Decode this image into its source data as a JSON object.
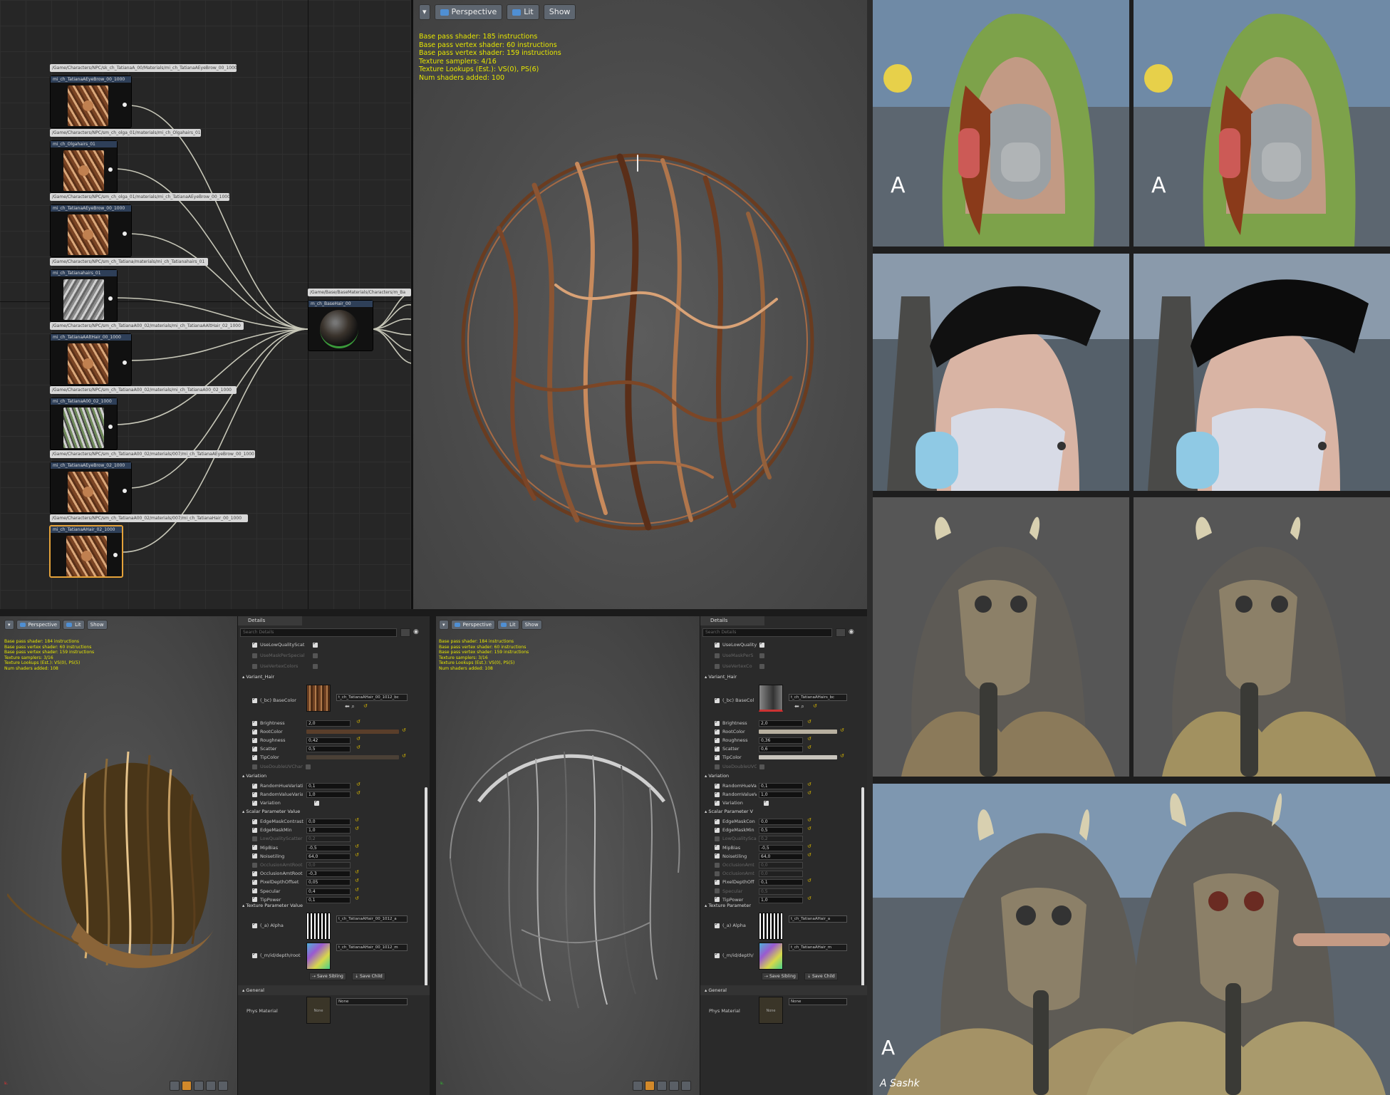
{
  "graph": {
    "nodes": [
      {
        "path": "/Game/Characters/NPC/sk_ch_TatianaA_00/Materials/mi_ch_TatianaAEyeBrow_00_1000",
        "title": "mi_ch_TatianaAEyeBrow_00_1000"
      },
      {
        "path": "/Game/Characters/NPC/sm_ch_olga_01/materials/mi_ch_Olgahairs_01",
        "title": "mi_ch_Olgahairs_01"
      },
      {
        "path": "/Game/Characters/NPC/sm_ch_olga_01/materials/mi_ch_TatianaAEyeBrow_00_1000",
        "title": "mi_ch_TatianaAEyeBrow_00_1000"
      },
      {
        "path": "/Game/Characters/NPC/sm_ch_Tatiana/materials/mi_ch_Tatianahairs_01",
        "title": "mi_ch_Tatianahairs_01"
      },
      {
        "path": "/Game/Characters/NPC/sm_ch_TatianaA00_02/materials/mi_ch_TatianaAAltHair_02_1000",
        "title": "mi_ch_TatianaAAltHair_00_1000"
      },
      {
        "path": "/Game/Characters/NPC/sm_ch_TatianaA00_02/materials/mi_ch_TatianaA00_02_1000",
        "title": "mi_ch_TatianaA00_02_1000"
      },
      {
        "path": "/Game/Characters/NPC/sm_ch_TatianaA00_02/materials/007/mi_ch_TatianaAEyeBrow_00_1000",
        "title": "mi_ch_TatianaAEyeBrow_02_1000"
      },
      {
        "path": "/Game/Characters/NPC/sm_ch_TatianaA00_02/materials/007/mi_ch_TatianaHair_00_1000",
        "title": "mi_ch_TatianaAHair_02_1000"
      }
    ],
    "base_node": {
      "path": "/Game/Base/BaseMaterials/Characters/m_Ba",
      "title": "m_ch_BaseHair_00"
    }
  },
  "top_viewport": {
    "buttons": {
      "perspective": "Perspective",
      "lit": "Lit",
      "show": "Show"
    },
    "stats": "Base pass shader: 185 instructions\nBase pass vertex shader: 60 instructions\nBase pass vertex shader: 159 instructions\nTexture samplers: 4/16\nTexture Lookups (Est.): VS(0), PS(6)\nNum shaders added: 100"
  },
  "bottom_viewports": [
    {
      "buttons": {
        "perspective": "Perspective",
        "lit": "Lit",
        "show": "Show"
      },
      "stats": "Base pass shader: 184 instructions\nBase pass vertex shader: 60 instructions\nBase pass vertex shader: 159 instructions\nTexture samplers: 3/16\nTexture Lookups (Est.): VS(0), PS(5)\nNum shaders added: 108"
    },
    {
      "buttons": {
        "perspective": "Perspective",
        "lit": "Lit",
        "show": "Show"
      },
      "stats": "Base pass shader: 184 instructions\nBase pass vertex shader: 60 instructions\nBase pass vertex shader: 159 instructions\nTexture samplers: 3/16\nTexture Lookups (Est.): VS(0), PS(5)\nNum shaders added: 108"
    }
  ],
  "details": [
    {
      "tab": "Details",
      "search_placeholder": "Search Details",
      "top_rows": [
        {
          "label": "UseLowQualityScat",
          "on": true,
          "dim": false
        },
        {
          "label": "UseMaskPerSpecial",
          "on": false,
          "dim": true
        },
        {
          "label": "UseVertexColors",
          "on": false,
          "dim": true
        }
      ],
      "variant_hair": "Variant_Hair",
      "basecolor_label": "(_bc) BaseColor",
      "basecolor_texture": "t_ch_TatianaAHair_00_1012_bc",
      "scalars1": [
        {
          "label": "Brightness",
          "value": "2,0"
        },
        {
          "label": "RootColor",
          "value": ""
        },
        {
          "label": "Roughness",
          "value": "0,42"
        },
        {
          "label": "Scatter",
          "value": "0,5"
        },
        {
          "label": "TipColor",
          "value": ""
        },
        {
          "label": "UseDoubleUVChannel",
          "value": ""
        }
      ],
      "variation": "Variation",
      "variation_rows": [
        {
          "label": "RandomHueVariati",
          "value": "0,1"
        },
        {
          "label": "RandomValueVaria",
          "value": "1,0"
        },
        {
          "label": "Variation",
          "value": ""
        }
      ],
      "scalar_param": "Scalar Parameter Value",
      "scalar_rows": [
        {
          "label": "EdgeMaskContrast",
          "value": "0,0",
          "dim": false
        },
        {
          "label": "EdgeMaskMin",
          "value": "1,0",
          "dim": false
        },
        {
          "label": "LowQualityScatter",
          "value": "0,2",
          "dim": true
        },
        {
          "label": "MipBias",
          "value": "-0,5",
          "dim": false
        },
        {
          "label": "Noisetiling",
          "value": "64,0",
          "dim": false
        },
        {
          "label": "OcclusionAmtRoot",
          "value": "0,0",
          "dim": true
        },
        {
          "label": "OcclusionAmtRoot",
          "value": "-0,3",
          "dim": false
        },
        {
          "label": "PixelDepthOffset",
          "value": "0,05",
          "dim": false
        },
        {
          "label": "Specular",
          "value": "0,4",
          "dim": false
        },
        {
          "label": "TipPower",
          "value": "0,1",
          "dim": false
        }
      ],
      "texture_param": "Texture Parameter Value",
      "alpha_label": "(_a) Alpha",
      "alpha_texture": "t_ch_TatianaAHair_00_1012_a",
      "depth_label": "(_m/id/depth/root",
      "depth_texture": "t_ch_TatianaAHair_00_1012_m",
      "save_sibling": "Save Sibling",
      "save_child": "Save Child",
      "general": "General",
      "phys_material": "Phys Material",
      "phys_value": "None",
      "phys_thumb": "None"
    },
    {
      "tab": "Details",
      "search_placeholder": "Search Details",
      "top_rows": [
        {
          "label": "UseLowQuality",
          "on": true,
          "dim": false
        },
        {
          "label": "UseMaskPerS",
          "on": false,
          "dim": true
        },
        {
          "label": "UseVertexCo",
          "on": false,
          "dim": true
        }
      ],
      "variant_hair": "Variant_Hair",
      "basecolor_label": "(_bc) BaseCol",
      "basecolor_texture": "t_ch_TatianaAHairs_bc",
      "scalars1": [
        {
          "label": "Brightness",
          "value": "2,0"
        },
        {
          "label": "RootColor",
          "value": ""
        },
        {
          "label": "Roughness",
          "value": "0,36"
        },
        {
          "label": "Scatter",
          "value": "0,6"
        },
        {
          "label": "TipColor",
          "value": ""
        },
        {
          "label": "UseDoubleUVChan",
          "value": ""
        }
      ],
      "variation": "Variation",
      "variation_rows": [
        {
          "label": "RandomHueVa",
          "value": "0,1"
        },
        {
          "label": "RandomValueV",
          "value": "1,0"
        },
        {
          "label": "Variation",
          "value": ""
        }
      ],
      "scalar_param": "Scalar Parameter V",
      "scalar_rows": [
        {
          "label": "EdgeMaskCon",
          "value": "0,0",
          "dim": false
        },
        {
          "label": "EdgeMaskMin",
          "value": "0,5",
          "dim": false
        },
        {
          "label": "LowQualitySca",
          "value": "0,2",
          "dim": true
        },
        {
          "label": "MipBias",
          "value": "-0,5",
          "dim": false
        },
        {
          "label": "Noisetiling",
          "value": "64,0",
          "dim": false
        },
        {
          "label": "OcclusionAmt",
          "value": "0,0",
          "dim": true
        },
        {
          "label": "OcclusionAmt",
          "value": "0,0",
          "dim": true
        },
        {
          "label": "PixelDepthOff",
          "value": "0,1",
          "dim": false
        },
        {
          "label": "Specular",
          "value": "0,5",
          "dim": true
        },
        {
          "label": "TipPower",
          "value": "1,0",
          "dim": false
        }
      ],
      "texture_param": "Texture Parameter",
      "alpha_label": "(_a) Alpha",
      "alpha_texture": "t_ch_TatianaAHair_a",
      "depth_label": "(_m/id/depth/",
      "depth_texture": "t_ch_TatianaAHair_m",
      "save_sibling": "Save Sibling",
      "save_child": "Save Child",
      "general": "General",
      "phys_material": "Phys Material",
      "phys_value": "None",
      "phys_thumb": "None"
    }
  ],
  "watermarks": {
    "a1": "A",
    "a2": "A",
    "a3": "A",
    "sashko": "A Sashk"
  },
  "colors": {
    "accent_select": "#e5a23a",
    "stats_text": "#e6e600",
    "lit_icon": "#4f8fd4"
  }
}
